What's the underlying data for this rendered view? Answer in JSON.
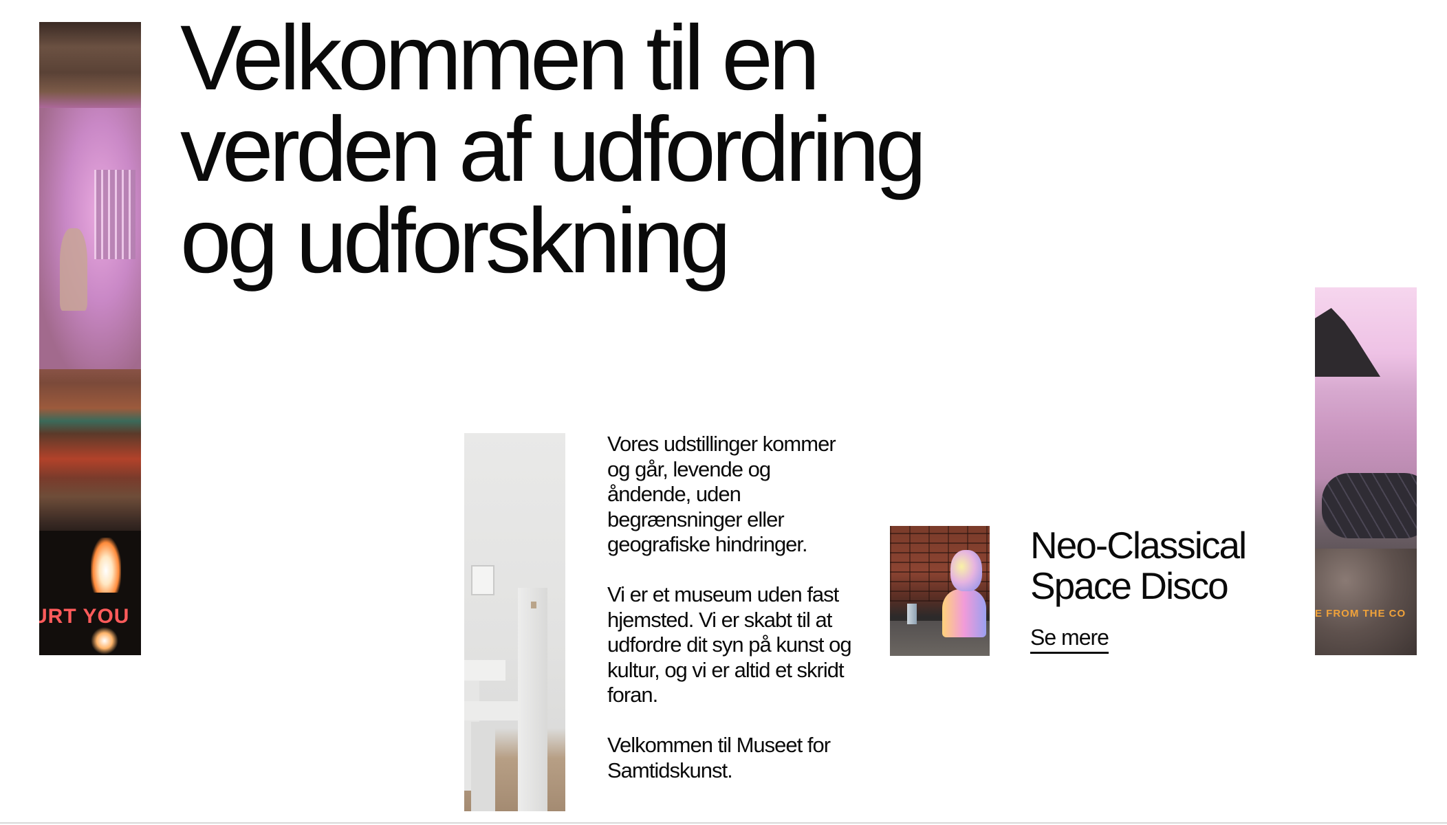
{
  "hero": {
    "headline_lines": [
      "Velkommen til en",
      "verden af udfordring",
      "og udforskning"
    ]
  },
  "images": {
    "tv_strip": {
      "icon": "tv-still-image",
      "overlay_text": "URT YOU"
    },
    "gallery_strip": {
      "icon": "gallery-interior-image"
    },
    "bust_thumbnail": {
      "icon": "neon-bust-image"
    },
    "beach_strip": {
      "icon": "beach-sunset-image",
      "overlay_text": "E FROM THE CO"
    }
  },
  "intro": {
    "paragraphs": [
      "Vores udstillinger kommer og går, levende og åndende, uden begrænsninger eller geografiske hindringer.",
      "Vi er et museum uden fast hjemsted. Vi er skabt til at udfordre dit syn på kunst og kultur, og vi er altid et skridt foran.",
      "Velkommen til Museet for Samtidskunst."
    ]
  },
  "exhibition": {
    "title_lines": [
      "Neo-Classical",
      "Space Disco"
    ],
    "link_label": "Se mere"
  },
  "colors": {
    "text": "#0a0a0a",
    "background": "#ffffff",
    "tv_caption": "#ff5b5b",
    "beach_caption": "#f0a23a"
  }
}
